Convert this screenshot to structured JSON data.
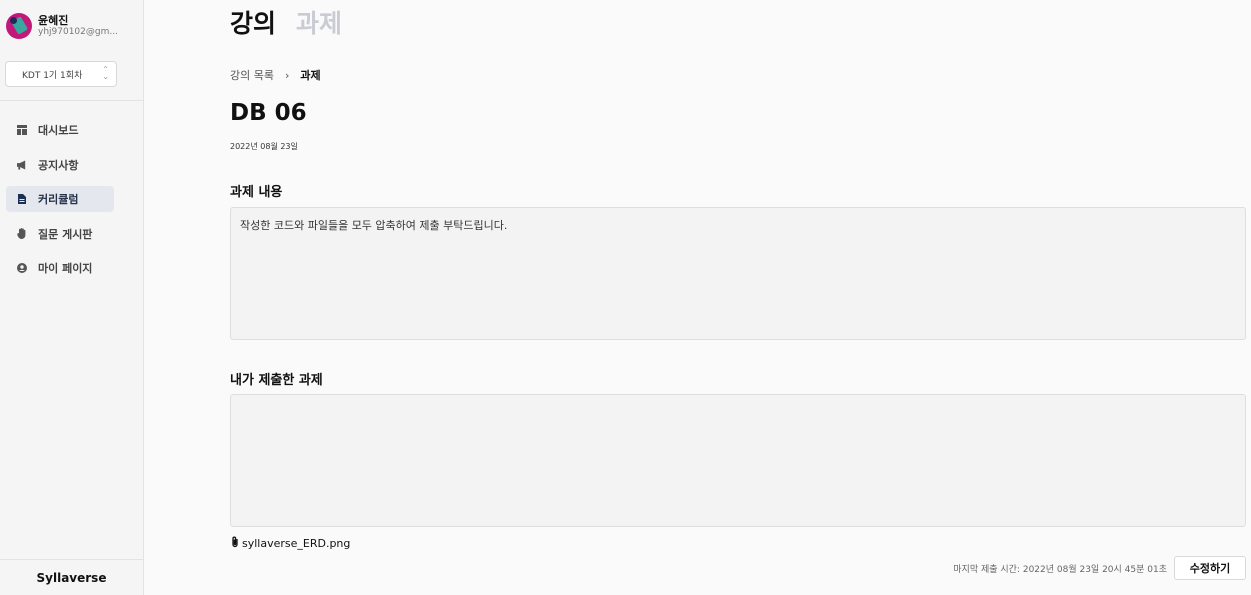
{
  "profile": {
    "name": "윤혜진",
    "email": "yhj970102@gm..."
  },
  "course_select": {
    "value": "KDT 1기 1회차"
  },
  "sidebar": {
    "items": [
      {
        "label": "대시보드",
        "icon": "dashboard-icon",
        "active": false
      },
      {
        "label": "공지사항",
        "icon": "megaphone-icon",
        "active": false
      },
      {
        "label": "커리큘럼",
        "icon": "document-icon",
        "active": true
      },
      {
        "label": "질문 게시판",
        "icon": "hand-icon",
        "active": false
      },
      {
        "label": "마이 페이지",
        "icon": "user-circle-icon",
        "active": false
      }
    ],
    "brand": "Syllaverse"
  },
  "tabs": [
    {
      "label": "강의",
      "active": true
    },
    {
      "label": "과제",
      "active": false
    }
  ],
  "breadcrumb": {
    "parent": "강의 목록",
    "current": "과제"
  },
  "assignment": {
    "title": "DB 06",
    "date": "2022년 08월 23일",
    "content_heading": "과제 내용",
    "content": "작성한 코드와 파일들을 모두 압축하여 제출 부탁드립니다.",
    "submission_heading": "내가 제출한 과제",
    "submission_text": "",
    "attachment_name": "syllaverse_ERD.png",
    "last_submit": "마지막 제출 시간: 2022년 08월 23일 20시 45분 01초",
    "edit_label": "수정하기"
  }
}
